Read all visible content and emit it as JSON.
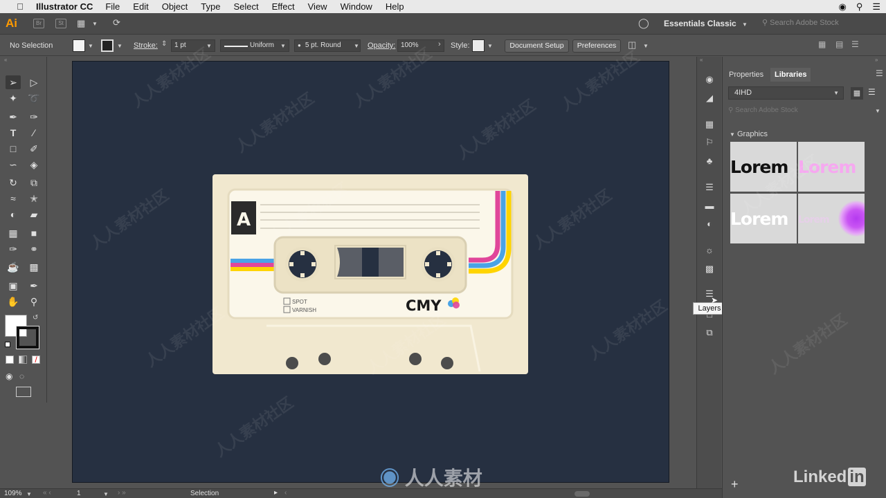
{
  "menubar": {
    "app_name": "Illustrator CC",
    "items": [
      "File",
      "Edit",
      "Object",
      "Type",
      "Select",
      "Effect",
      "View",
      "Window",
      "Help"
    ]
  },
  "appbar": {
    "logo": "Ai",
    "workspace": "Essentials Classic",
    "search_placeholder": "Search Adobe Stock"
  },
  "control": {
    "selection": "No Selection",
    "stroke_label": "Stroke:",
    "stroke_weight": "1 pt",
    "stroke_profile": "Uniform",
    "brush": "5 pt. Round",
    "opacity_label": "Opacity:",
    "opacity_value": "100%",
    "style_label": "Style:",
    "doc_setup": "Document Setup",
    "preferences": "Preferences"
  },
  "artwork": {
    "side_letter": "A",
    "checkboxes": [
      "SPOT",
      "VARNISH"
    ],
    "brand": "CMY",
    "colors": {
      "artboard": "#263041",
      "shell": "#f1e8cf",
      "cyan": "#4aa3e6",
      "magenta": "#e0469a",
      "yellow": "#ffd400"
    }
  },
  "panel": {
    "tabs": [
      "Properties",
      "Libraries"
    ],
    "library": "4IHD",
    "search_placeholder": "Search Adobe Stock",
    "section": "Graphics",
    "thumbs": [
      "Lorem",
      "Lorem",
      "Lorem",
      "Lorem"
    ],
    "tooltip": "Layers"
  },
  "status": {
    "zoom": "109%",
    "artboard": "1",
    "tool": "Selection"
  },
  "watermark": {
    "text": "人人素材社区",
    "brand": "人人素材",
    "linkedin": "Linked",
    "linkedin_in": "in"
  }
}
